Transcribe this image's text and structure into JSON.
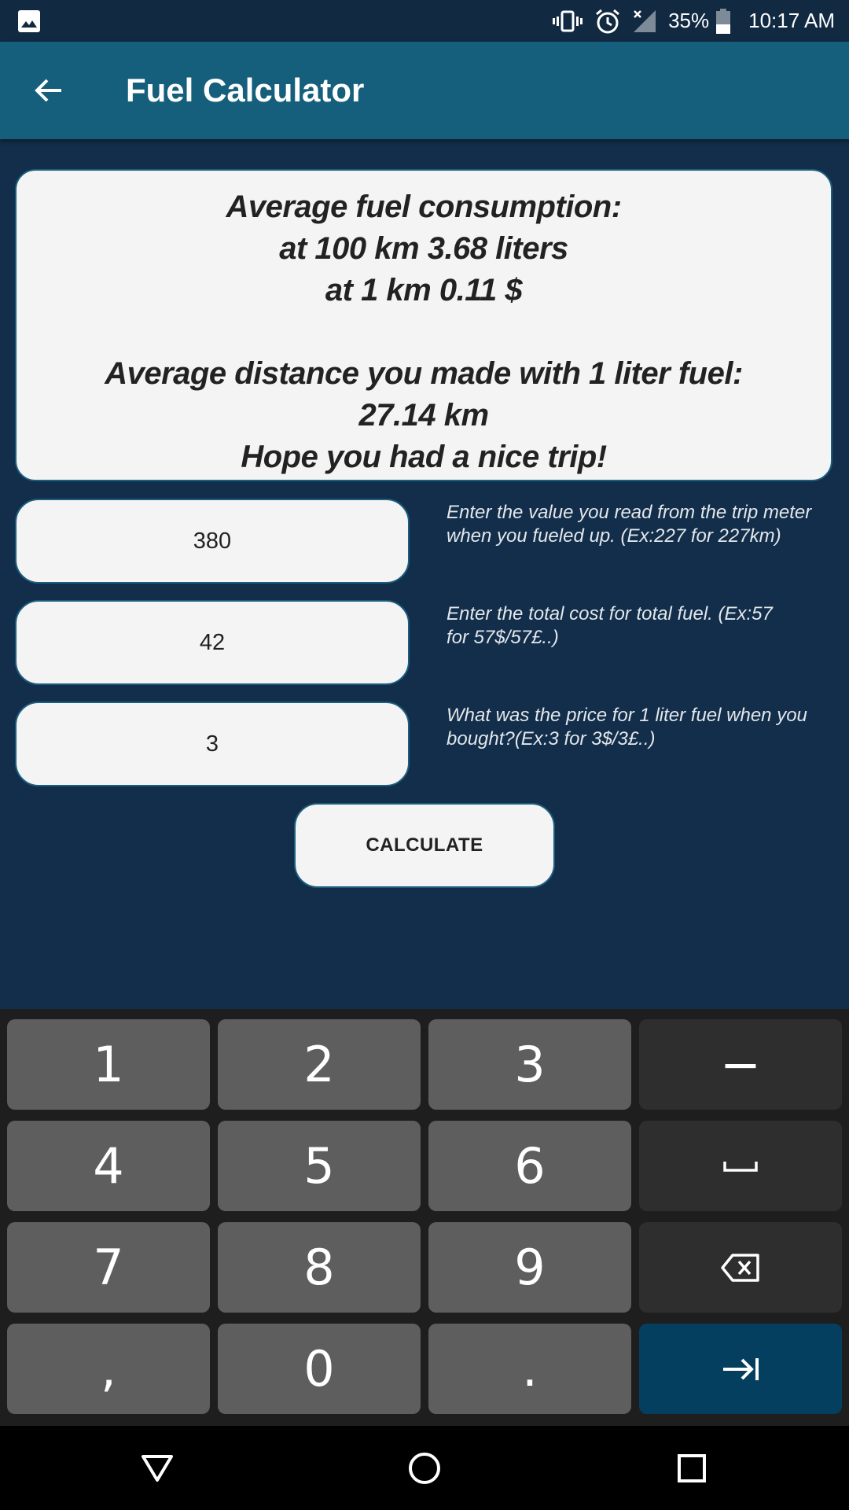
{
  "status_bar": {
    "battery": "35%",
    "time": "10:17 AM",
    "icons": [
      "gallery-icon",
      "vibrate-icon",
      "alarm-icon",
      "no-signal-icon",
      "battery-icon"
    ]
  },
  "app_bar": {
    "title": "Fuel Calculator",
    "back_icon": "arrow-left-icon"
  },
  "result": {
    "line1": "Average fuel consumption:",
    "line2": "at 100 km 3.68 liters",
    "line3": "at 1 km 0.11 $",
    "line4": "Average distance you made with 1 liter fuel:",
    "line5": "27.14 km",
    "line6": "Hope you had a nice trip!"
  },
  "form": {
    "distance": {
      "value": "380",
      "hint": "Enter the value you read from the trip meter when you fueled up. (Ex:227 for 227km)"
    },
    "total_cost": {
      "value": "42",
      "hint": "Enter the total cost for total fuel. (Ex:57 for 57$/57£..)"
    },
    "price_per_liter": {
      "value": "3",
      "hint": "What was the price for 1 liter fuel when you bought?(Ex:3 for 3$/3£..)"
    },
    "calculate_label": "CALCULATE"
  },
  "keyboard": {
    "keys": [
      "1",
      "2",
      "3",
      "−",
      "4",
      "5",
      "6",
      "␣",
      "7",
      "8",
      "9",
      "⌫",
      ",",
      "0",
      ".",
      "⇥"
    ],
    "k1": "1",
    "k2": "2",
    "k3": "3",
    "minus": "−",
    "k4": "4",
    "k5": "5",
    "k6": "6",
    "k7": "7",
    "k8": "8",
    "k9": "9",
    "comma": ",",
    "k0": "0",
    "dot": ".",
    "accent_color": "#043f60"
  },
  "nav_bar": {
    "icons": [
      "back-triangle-icon",
      "home-circle-icon",
      "recents-square-icon"
    ]
  },
  "colors": {
    "background": "#122e4a",
    "app_bar": "#155f7c",
    "status_bar": "#112941",
    "card": "#f4f4f4",
    "card_border": "#1b5e7e"
  }
}
